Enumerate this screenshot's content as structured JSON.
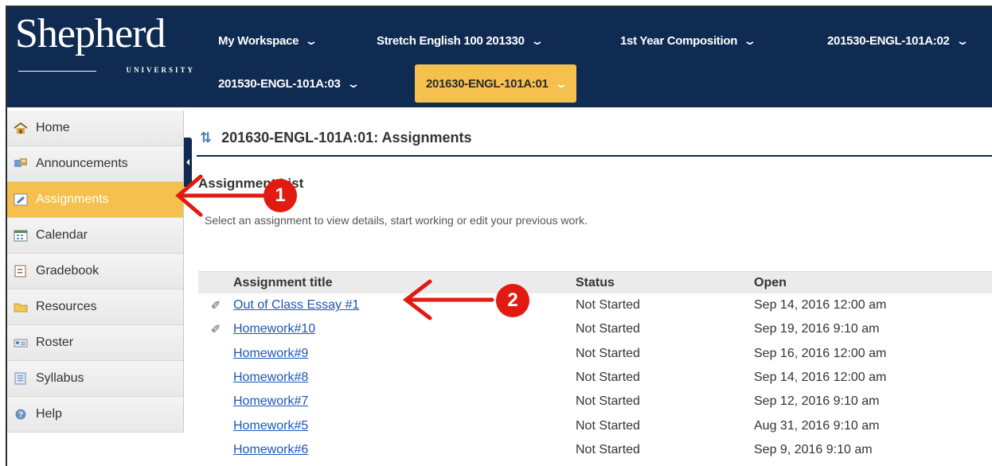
{
  "logo": {
    "word": "Shepherd",
    "subtitle": "UNIVERSITY"
  },
  "nav": {
    "items": [
      {
        "label": "My Workspace"
      },
      {
        "label": "Stretch English 100 201330"
      },
      {
        "label": "1st Year Composition"
      },
      {
        "label": "201530-ENGL-101A:02"
      },
      {
        "label": "201530-ENGL-101A:03"
      },
      {
        "label": "201630-ENGL-101A:01",
        "active": true
      }
    ]
  },
  "sidebar": {
    "items": [
      {
        "label": "Home",
        "icon": "home-icon"
      },
      {
        "label": "Announcements",
        "icon": "announcements-icon"
      },
      {
        "label": "Assignments",
        "icon": "assignments-icon",
        "active": true
      },
      {
        "label": "Calendar",
        "icon": "calendar-icon"
      },
      {
        "label": "Gradebook",
        "icon": "gradebook-icon"
      },
      {
        "label": "Resources",
        "icon": "folder-icon"
      },
      {
        "label": "Roster",
        "icon": "roster-icon"
      },
      {
        "label": "Syllabus",
        "icon": "syllabus-icon"
      },
      {
        "label": "Help",
        "icon": "help-icon"
      }
    ]
  },
  "main": {
    "title": "201630-ENGL-101A:01: Assignments",
    "section": "Assignment List",
    "instructions": "Select an assignment to view details, start working or edit your previous work.",
    "table": {
      "headers": {
        "title": "Assignment title",
        "status": "Status",
        "open": "Open"
      },
      "rows": [
        {
          "clip": "✐",
          "title": "Out of Class Essay #1",
          "status": "Not Started",
          "open": "Sep 14, 2016 12:00 am"
        },
        {
          "clip": "✐",
          "title": "Homework#10",
          "status": "Not Started",
          "open": "Sep 19, 2016 9:10 am"
        },
        {
          "clip": "",
          "title": "Homework#9",
          "status": "Not Started",
          "open": "Sep 16, 2016 12:00 am"
        },
        {
          "clip": "",
          "title": "Homework#8",
          "status": "Not Started",
          "open": "Sep 14, 2016 12:00 am"
        },
        {
          "clip": "",
          "title": "Homework#7",
          "status": "Not Started",
          "open": "Sep 12, 2016 9:10 am"
        },
        {
          "clip": "",
          "title": "Homework#5",
          "status": "Not Started",
          "open": "Aug 31, 2016 9:10 am"
        },
        {
          "clip": "",
          "title": "Homework#6",
          "status": "Not Started",
          "open": "Sep 9, 2016 9:10 am"
        }
      ]
    }
  },
  "annotations": {
    "badge1": "1",
    "badge2": "2",
    "arrow_color": "#e11a12"
  },
  "colors": {
    "header": "#0f2b52",
    "accent": "#f5c04d",
    "link": "#1a57b8"
  }
}
